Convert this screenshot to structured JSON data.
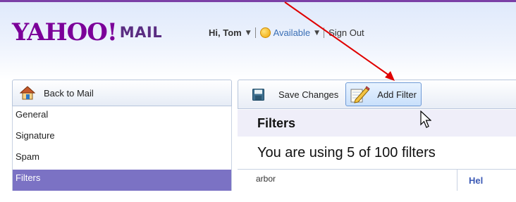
{
  "header": {
    "logo_yahoo": "YAHOO!",
    "logo_mail": "MAIL",
    "greeting": "Hi, Tom",
    "status": "Available",
    "signout": "Sign Out"
  },
  "leftnav": {
    "back_label": "Back to Mail",
    "items": [
      {
        "label": "General"
      },
      {
        "label": "Signature"
      },
      {
        "label": "Spam"
      },
      {
        "label": "Filters",
        "active": true
      }
    ]
  },
  "toolbar": {
    "save_label": "Save Changes",
    "add_filter_label": "Add Filter"
  },
  "main": {
    "title": "Filters",
    "usage_text": "You are using 5 of 100 filters",
    "table_first_cell": "arbor",
    "table_second_cell": "Hel"
  },
  "colors": {
    "brand_purple": "#7b0099",
    "active_nav": "#7b72c4",
    "arrow": "#e00000",
    "link_blue": "#3a6fb5"
  },
  "icons": {
    "home": "home-icon",
    "save": "floppy-disk-icon",
    "add_filter": "pencil-icon",
    "status": "smiley-status-icon",
    "cursor": "mouse-pointer-icon"
  }
}
